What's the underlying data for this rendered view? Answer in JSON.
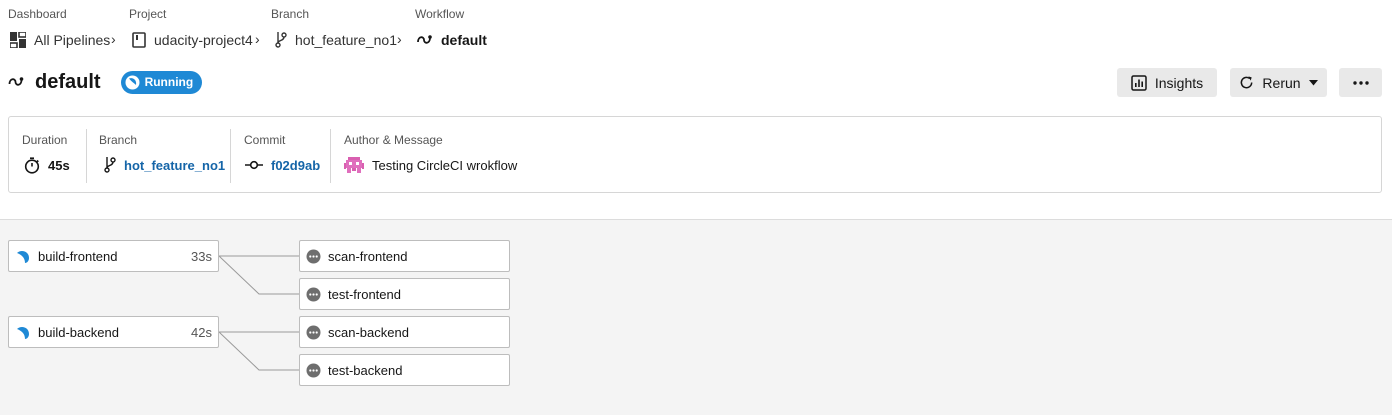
{
  "breadcrumb": {
    "dashboard": {
      "label": "Dashboard",
      "value": "All Pipelines"
    },
    "project": {
      "label": "Project",
      "value": "udacity-project4"
    },
    "branch": {
      "label": "Branch",
      "value": "hot_feature_no1"
    },
    "workflow": {
      "label": "Workflow",
      "value": "default"
    },
    "separator": "›"
  },
  "header": {
    "title": "default",
    "status": "Running",
    "status_color": "#1f89d5",
    "buttons": {
      "insights": "Insights",
      "rerun": "Rerun",
      "more": "more-icon"
    }
  },
  "info": {
    "duration": {
      "label": "Duration",
      "value": "45s"
    },
    "branch": {
      "label": "Branch",
      "value": "hot_feature_no1"
    },
    "commit": {
      "label": "Commit",
      "value": "f02d9ab"
    },
    "author": {
      "label": "Author & Message",
      "value": "Testing CircleCI wrokflow"
    }
  },
  "workflow": {
    "jobs": [
      {
        "name": "build-frontend",
        "duration": "33s",
        "status": "running"
      },
      {
        "name": "scan-frontend",
        "duration": "",
        "status": "queued"
      },
      {
        "name": "test-frontend",
        "duration": "",
        "status": "queued"
      },
      {
        "name": "build-backend",
        "duration": "42s",
        "status": "running"
      },
      {
        "name": "scan-backend",
        "duration": "",
        "status": "queued"
      },
      {
        "name": "test-backend",
        "duration": "",
        "status": "queued"
      }
    ]
  },
  "colors": {
    "link": "#1565a8",
    "running": "#1f89d5",
    "queued": "#6e6e6e"
  }
}
